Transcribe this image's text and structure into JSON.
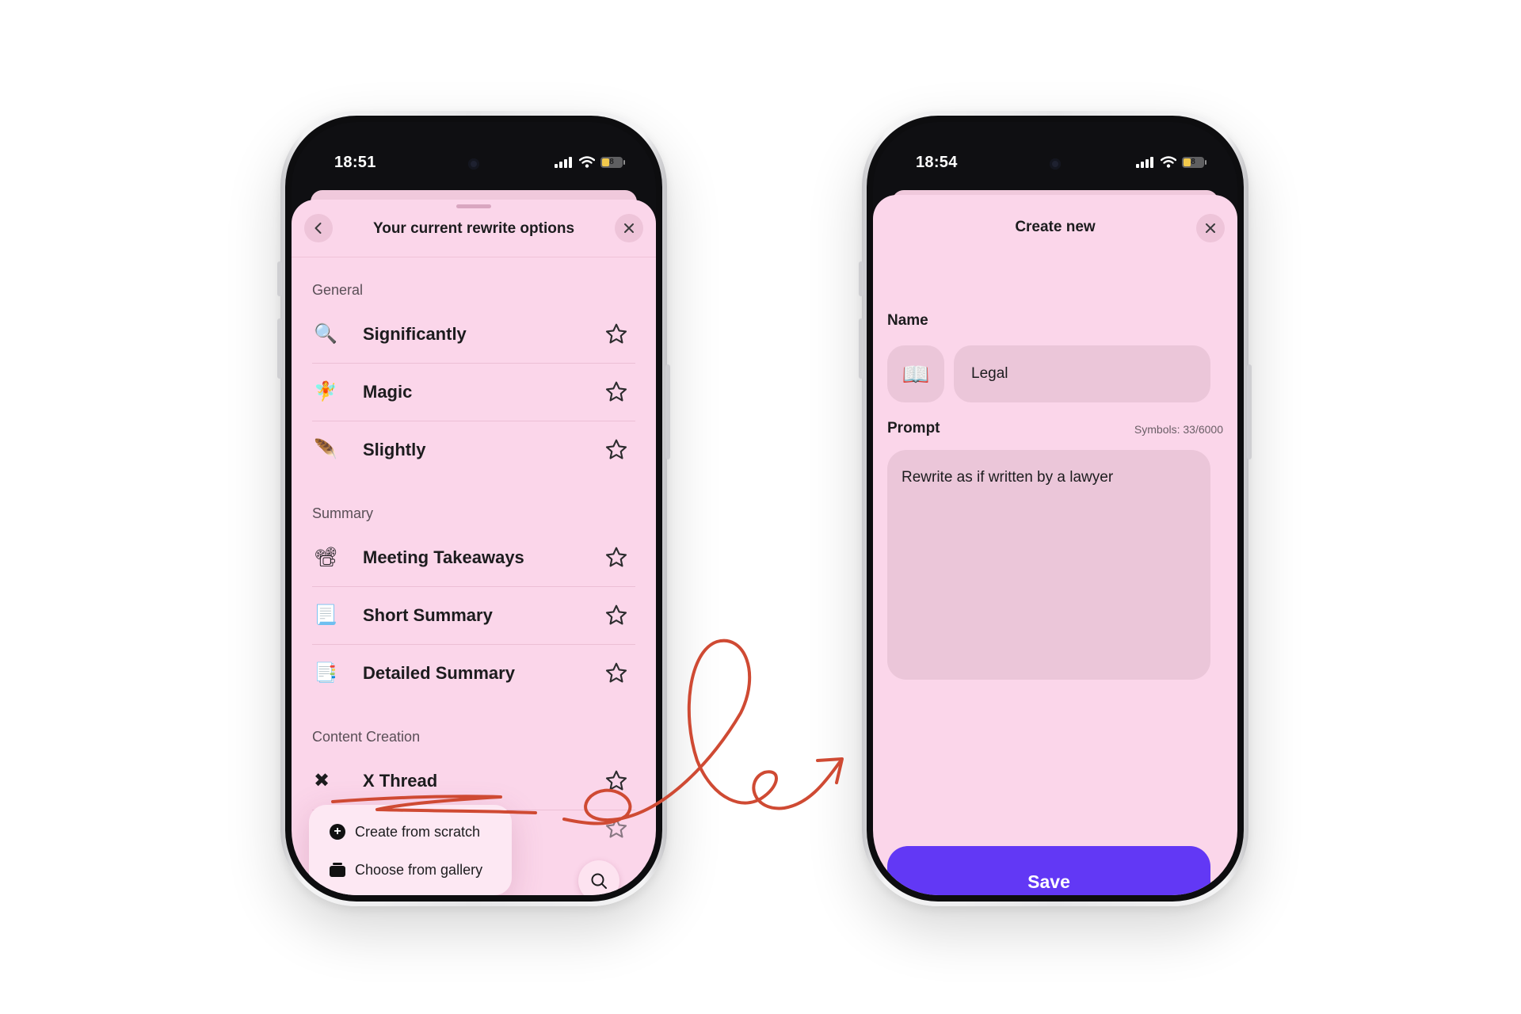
{
  "colors": {
    "sheet_background": "#fbd6ea",
    "input_background": "#ebc6d9",
    "save_button": "#6238f5",
    "annotation_stroke": "#cf4a33"
  },
  "left_phone": {
    "status_time": "18:51",
    "battery_level": "8",
    "header": {
      "title": "Your current rewrite options",
      "back_icon": "chevron-left-icon",
      "close_icon": "close-icon"
    },
    "sections": [
      {
        "title": "General",
        "items": [
          {
            "label": "Significantly",
            "icon": "🔍",
            "starred": false
          },
          {
            "label": "Magic",
            "icon": "🧚",
            "starred": false
          },
          {
            "label": "Slightly",
            "icon": "🪶",
            "starred": false
          }
        ]
      },
      {
        "title": "Summary",
        "items": [
          {
            "label": "Meeting Takeaways",
            "icon": "📽",
            "starred": false
          },
          {
            "label": "Short Summary",
            "icon": "📃",
            "starred": false
          },
          {
            "label": "Detailed Summary",
            "icon": "📑",
            "starred": false
          }
        ]
      },
      {
        "title": "Content Creation",
        "items": [
          {
            "label": "X Thread",
            "icon": "✖",
            "starred": false
          }
        ]
      }
    ],
    "popup_menu": {
      "create_label": "Create from scratch",
      "gallery_label": "Choose from gallery"
    },
    "search_icon": "search-icon"
  },
  "right_phone": {
    "status_time": "18:54",
    "battery_level": "8",
    "header": {
      "title": "Create new",
      "close_icon": "close-icon"
    },
    "name_label": "Name",
    "name_icon": "📖",
    "name_value": "Legal",
    "prompt_label": "Prompt",
    "symbols_counter": "Symbols: 33/6000",
    "prompt_value": "Rewrite as if written by a lawyer",
    "save_label": "Save"
  }
}
